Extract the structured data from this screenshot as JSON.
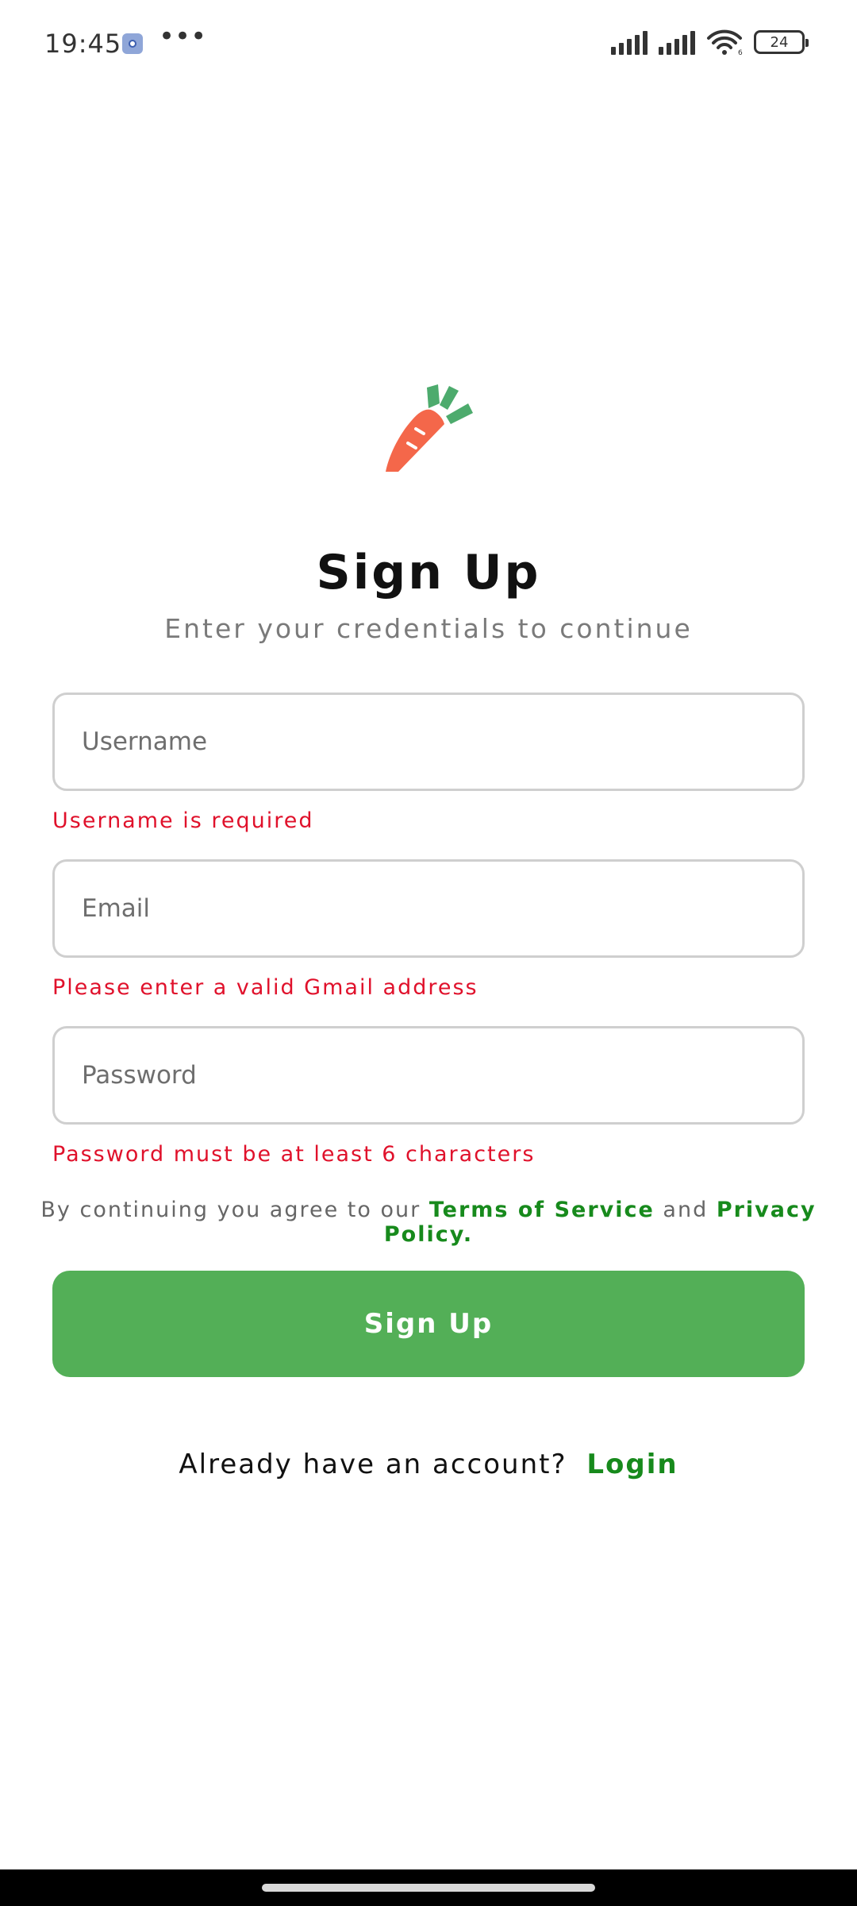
{
  "status_bar": {
    "time": "19:45",
    "more_icon": "more-dots-icon",
    "battery_level": "24",
    "wifi_label": "6"
  },
  "logo": {
    "icon": "carrot-icon",
    "colors": {
      "body": "#f4674a",
      "leaves": "#4dab6d"
    }
  },
  "header": {
    "title": "Sign Up",
    "subtitle": "Enter your credentials to continue"
  },
  "form": {
    "username": {
      "placeholder": "Username",
      "value": "",
      "error": "Username is required"
    },
    "email": {
      "placeholder": "Email",
      "value": "",
      "error": "Please enter a valid Gmail address"
    },
    "password": {
      "placeholder": "Password",
      "value": "",
      "error": "Password must be at least 6 characters"
    }
  },
  "terms": {
    "prefix": "By continuing you agree to our",
    "terms_link": "Terms of Service",
    "and": "and",
    "privacy_link": "Privacy Policy."
  },
  "signup_button": {
    "label": "Sign Up"
  },
  "login": {
    "prompt": "Already have an account?",
    "link": "Login"
  },
  "colors": {
    "accent": "#53af57",
    "link": "#178a1c",
    "error": "#e0112b"
  }
}
